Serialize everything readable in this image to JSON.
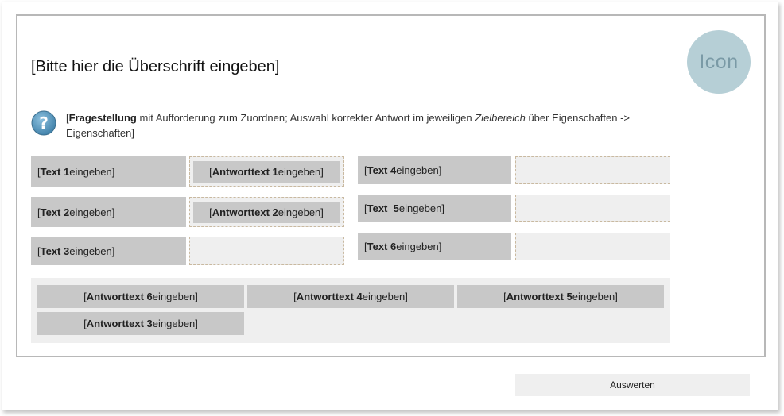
{
  "icon_label": "Icon",
  "title": "[Bitte hier die Überschrift eingeben]",
  "question": {
    "bracket_open": "[",
    "bold": "Fragestellung",
    "text1": " mit Aufforderung zum Zuordnen; Auswahl korrekter Antwort im jeweiligen ",
    "italic": "Zielbereich",
    "text2": " über Eigenschaften -> Eigenschaften]"
  },
  "targets": [
    {
      "bold": "Text 1",
      "rest": " eingeben]"
    },
    {
      "bold": "Text 2",
      "rest": " eingeben]"
    },
    {
      "bold": "Text 3",
      "rest": " eingeben]"
    },
    {
      "bold": "Text 4",
      "rest": " eingeben]"
    },
    {
      "bold": "Text  5",
      "rest": " eingeben]"
    },
    {
      "bold": "Text 6",
      "rest": " eingeben]"
    }
  ],
  "placed_answers": [
    {
      "bold": "Antworttext 1",
      "rest": " eingeben]"
    },
    {
      "bold": "Antworttext 2",
      "rest": " eingeben]"
    }
  ],
  "pool_answers": [
    {
      "bold": "Antworttext 6",
      "rest": " eingeben]"
    },
    {
      "bold": "Antworttext 4",
      "rest": " eingeben]"
    },
    {
      "bold": "Antworttext 5",
      "rest": " eingeben]"
    },
    {
      "bold": "Antworttext 3",
      "rest": " eingeben]"
    }
  ],
  "bracket": "[",
  "evaluate_button": "Auswerten",
  "colors": {
    "icon_circle": "#b6cfd6",
    "question_icon": "#4f90b8",
    "label_bg": "#c8c8c8",
    "zone_bg": "#efefef",
    "zone_border": "#c9b9a0"
  }
}
